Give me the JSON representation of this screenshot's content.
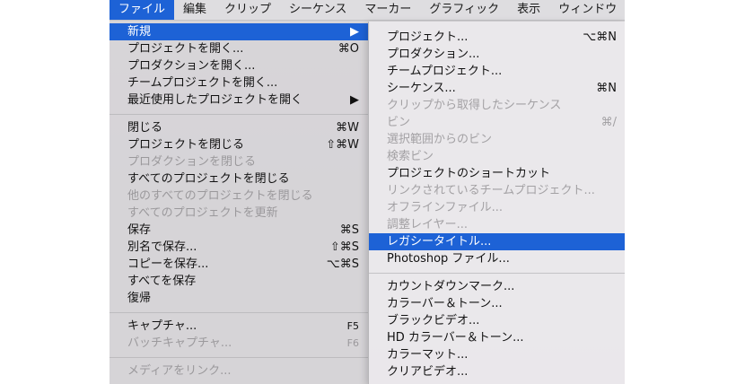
{
  "menubar": {
    "items": [
      "ファイル",
      "編集",
      "クリップ",
      "シーケンス",
      "マーカー",
      "グラフィック",
      "表示",
      "ウィンドウ",
      "ヘ"
    ],
    "active_index": 0
  },
  "file_menu": {
    "new": {
      "label": "新規",
      "arrow": "▶"
    },
    "open_project": {
      "label": "プロジェクトを開く...",
      "shortcut": "⌘O"
    },
    "open_production": {
      "label": "プロダクションを開く..."
    },
    "open_team_project": {
      "label": "チームプロジェクトを開く..."
    },
    "open_recent": {
      "label": "最近使用したプロジェクトを開く",
      "arrow": "▶"
    },
    "close": {
      "label": "閉じる",
      "shortcut": "⌘W"
    },
    "close_project": {
      "label": "プロジェクトを閉じる",
      "shortcut": "⇧⌘W"
    },
    "close_production": {
      "label": "プロダクションを閉じる"
    },
    "close_all_projects": {
      "label": "すべてのプロジェクトを閉じる"
    },
    "close_other_projects": {
      "label": "他のすべてのプロジェクトを閉じる"
    },
    "refresh_all_projects": {
      "label": "すべてのプロジェクトを更新"
    },
    "save": {
      "label": "保存",
      "shortcut": "⌘S"
    },
    "save_as": {
      "label": "別名で保存...",
      "shortcut": "⇧⌘S"
    },
    "save_copy": {
      "label": "コピーを保存...",
      "shortcut": "⌥⌘S"
    },
    "save_all": {
      "label": "すべてを保存"
    },
    "revert": {
      "label": "復帰"
    },
    "capture": {
      "label": "キャプチャ...",
      "shortcut": "F5"
    },
    "batch_capture": {
      "label": "バッチキャプチャ...",
      "shortcut": "F6"
    },
    "link_media": {
      "label": "メディアをリンク..."
    }
  },
  "new_submenu": {
    "project": {
      "label": "プロジェクト...",
      "shortcut": "⌥⌘N"
    },
    "production": {
      "label": "プロダクション..."
    },
    "team_project": {
      "label": "チームプロジェクト..."
    },
    "sequence": {
      "label": "シーケンス...",
      "shortcut": "⌘N"
    },
    "sequence_from_clip": {
      "label": "クリップから取得したシーケンス"
    },
    "bin": {
      "label": "ビン",
      "shortcut": "⌘/"
    },
    "bin_from_selection": {
      "label": "選択範囲からのビン"
    },
    "search_bin": {
      "label": "検索ビン"
    },
    "project_shortcut": {
      "label": "プロジェクトのショートカット"
    },
    "linked_team_project": {
      "label": "リンクされているチームプロジェクト..."
    },
    "offline_file": {
      "label": "オフラインファイル..."
    },
    "adjustment_layer": {
      "label": "調整レイヤー..."
    },
    "legacy_title": {
      "label": "レガシータイトル..."
    },
    "photoshop_file": {
      "label": "Photoshop ファイル..."
    },
    "countdown": {
      "label": "カウントダウンマーク..."
    },
    "bars_tone": {
      "label": "カラーバー＆トーン..."
    },
    "black_video": {
      "label": "ブラックビデオ..."
    },
    "hd_bars_tone": {
      "label": "HD カラーバー＆トーン..."
    },
    "color_matte": {
      "label": "カラーマット..."
    },
    "clear_video": {
      "label": "クリアビデオ..."
    }
  }
}
